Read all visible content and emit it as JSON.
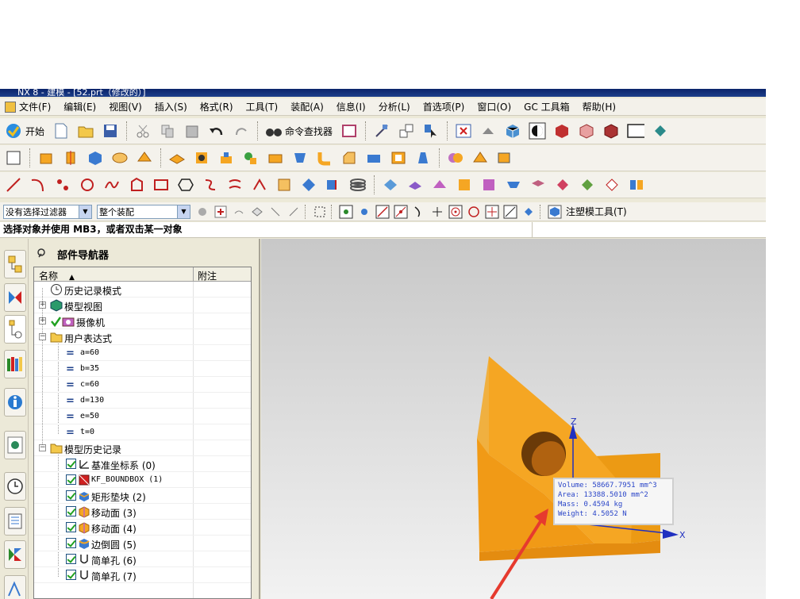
{
  "window": {
    "title": "NX 8 - 建模 - [52.prt（修改的）]"
  },
  "menu": [
    "文件(F)",
    "编辑(E)",
    "视图(V)",
    "插入(S)",
    "格式(R)",
    "工具(T)",
    "装配(A)",
    "信息(I)",
    "分析(L)",
    "首选项(P)",
    "窗口(O)",
    "GC 工具箱",
    "帮助(H)"
  ],
  "toolbar": {
    "start_label": "开始",
    "command_finder_label": "命令查找器"
  },
  "filterbar": {
    "type_filter": "没有选择过滤器",
    "scope": "整个装配",
    "mold_tools": "注塑模工具(T)"
  },
  "status": {
    "prompt": "选择对象并使用 MB3，或者双击某一对象"
  },
  "navigator": {
    "title": "部件导航器",
    "col_name": "名称",
    "col_note": "附注",
    "rows": {
      "history_mode": "历史记录模式",
      "model_views": "模型视图",
      "cameras": "摄像机",
      "user_expressions": "用户表达式",
      "expr_a": "a=60",
      "expr_b": "b=35",
      "expr_c": "c=60",
      "expr_d": "d=130",
      "expr_e": "e=50",
      "expr_t": "t=0",
      "model_history": "模型历史记录",
      "datum_csys": "基准坐标系 (0)",
      "kf_boundbox": "KF_BOUNDBOX (1)",
      "rect_pad": "矩形垫块 (2)",
      "move_face_3": "移动面 (3)",
      "move_face_4": "移动面 (4)",
      "edge_blend": "边倒圆 (5)",
      "simple_hole_6": "简单孔 (6)",
      "simple_hole_7": "简单孔 (7)"
    }
  },
  "measurement": {
    "volume": "Volume: 58667.7951 mm^3",
    "area": "Area: 13388.5010 mm^2",
    "mass": "Mass: 0.4594 kg",
    "weight": "Weight: 4.5052 N"
  },
  "axes": {
    "z": "Z",
    "x": "X"
  },
  "colors": {
    "part": "#f5a623",
    "part_dark": "#d98a10",
    "annotation_arrow": "#e63a2e",
    "axis": "#2030c0"
  }
}
